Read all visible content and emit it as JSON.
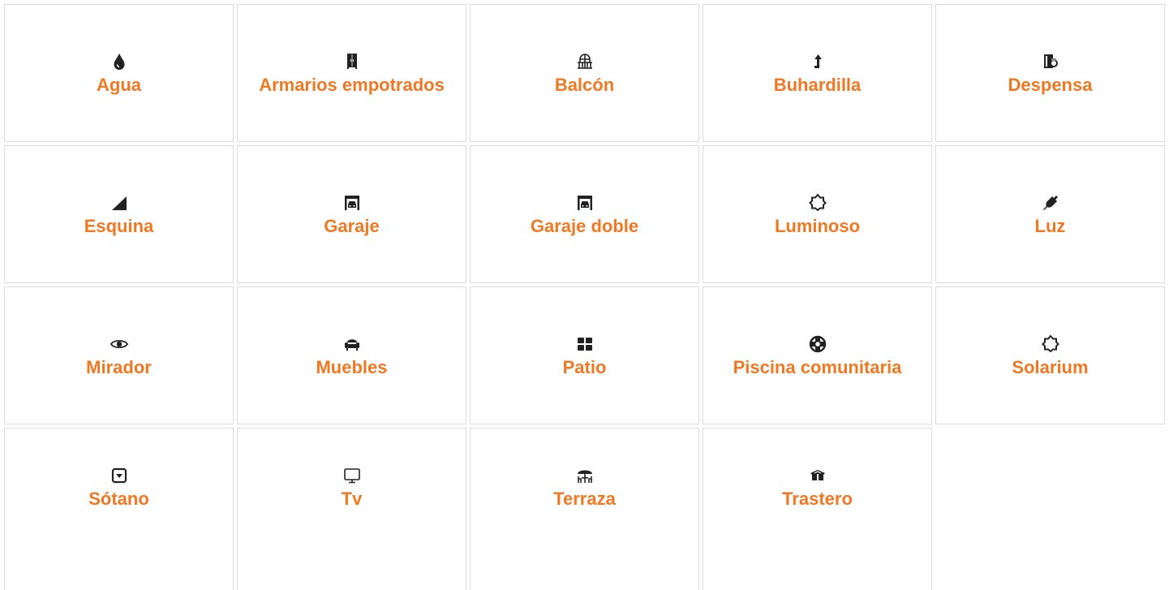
{
  "features": [
    {
      "id": "agua",
      "label": "Agua",
      "icon": "water-drop-icon"
    },
    {
      "id": "armarios-empotrados",
      "label": "Armarios empotrados",
      "icon": "wardrobe-icon"
    },
    {
      "id": "balcon",
      "label": "Balcón",
      "icon": "balcony-icon"
    },
    {
      "id": "buhardilla",
      "label": "Buhardilla",
      "icon": "arrow-up-turn-icon"
    },
    {
      "id": "despensa",
      "label": "Despensa",
      "icon": "pantry-icon"
    },
    {
      "id": "esquina",
      "label": "Esquina",
      "icon": "corner-triangle-icon"
    },
    {
      "id": "garaje",
      "label": "Garaje",
      "icon": "garage-icon"
    },
    {
      "id": "garaje-doble",
      "label": "Garaje doble",
      "icon": "garage-icon"
    },
    {
      "id": "luminoso",
      "label": "Luminoso",
      "icon": "sun-icon"
    },
    {
      "id": "luz",
      "label": "Luz",
      "icon": "plug-icon"
    },
    {
      "id": "mirador",
      "label": "Mirador",
      "icon": "eye-icon"
    },
    {
      "id": "muebles",
      "label": "Muebles",
      "icon": "armchair-icon"
    },
    {
      "id": "patio",
      "label": "Patio",
      "icon": "grid-squares-icon"
    },
    {
      "id": "piscina-comunitaria",
      "label": "Piscina comunitaria",
      "icon": "lifebuoy-icon"
    },
    {
      "id": "solarium",
      "label": "Solarium",
      "icon": "sun-icon"
    },
    {
      "id": "sotano",
      "label": "Sótano",
      "icon": "basement-box-icon"
    },
    {
      "id": "tv",
      "label": "Tv",
      "icon": "monitor-icon"
    },
    {
      "id": "terraza",
      "label": "Terraza",
      "icon": "terrace-table-icon"
    },
    {
      "id": "trastero",
      "label": "Trastero",
      "icon": "storage-box-icon"
    }
  ],
  "colors": {
    "label": "#f07822",
    "icon": "#222222",
    "border": "#dcdcdc"
  }
}
